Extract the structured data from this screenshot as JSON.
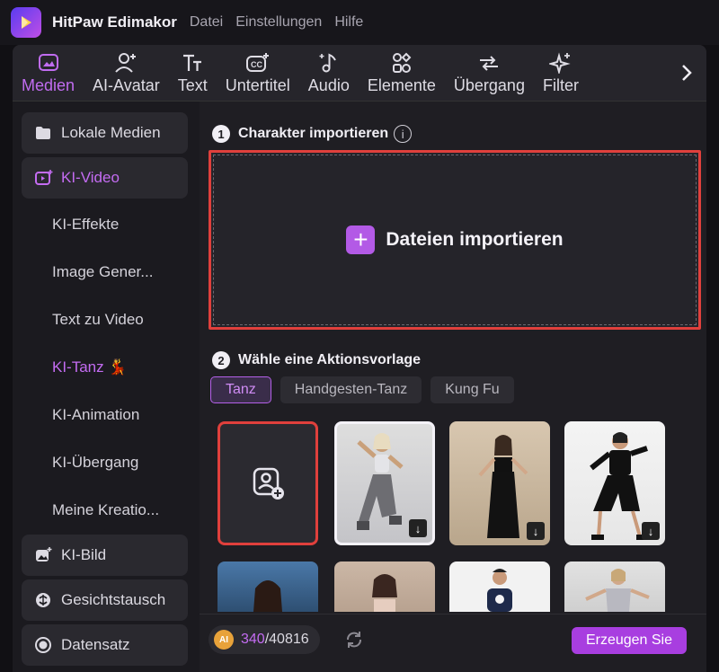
{
  "app": {
    "title": "HitPaw Edimakor"
  },
  "menu": [
    "Datei",
    "Einstellungen",
    "Hilfe"
  ],
  "toolbar": {
    "items": [
      {
        "label": "Medien",
        "icon": "media-icon",
        "active": true
      },
      {
        "label": "AI-Avatar",
        "icon": "avatar-icon"
      },
      {
        "label": "Text",
        "icon": "text-icon"
      },
      {
        "label": "Untertitel",
        "icon": "subtitle-icon"
      },
      {
        "label": "Audio",
        "icon": "audio-icon"
      },
      {
        "label": "Elemente",
        "icon": "elements-icon"
      },
      {
        "label": "Übergang",
        "icon": "transition-icon"
      },
      {
        "label": "Filter",
        "icon": "filter-icon"
      }
    ]
  },
  "sidebar": {
    "items": [
      {
        "label": "Lokale Medien",
        "icon": "folder-icon"
      },
      {
        "label": "KI-Video",
        "icon": "ai-video-icon",
        "active": true
      },
      {
        "label": "KI-Bild",
        "icon": "ai-image-icon"
      },
      {
        "label": "Gesichtstausch",
        "icon": "face-swap-icon"
      },
      {
        "label": "Datensatz",
        "icon": "dataset-icon"
      }
    ],
    "subitems": [
      {
        "label": "KI-Effekte"
      },
      {
        "label": "Image Gener..."
      },
      {
        "label": "Text zu Video"
      },
      {
        "label": "KI-Tanz 💃",
        "active": true
      },
      {
        "label": "KI-Animation"
      },
      {
        "label": "KI-Übergang"
      },
      {
        "label": "Meine Kreatio..."
      }
    ]
  },
  "main": {
    "step1": {
      "num": "1",
      "title": "Charakter importieren"
    },
    "import_label": "Dateien importieren",
    "step2": {
      "num": "2",
      "title": "Wähle eine Aktionsvorlage"
    },
    "tabs": [
      "Tanz",
      "Handgesten-Tanz",
      "Kung Fu"
    ],
    "credits": {
      "coin": "AI",
      "used": "340",
      "total": "/40816"
    },
    "generate_label": "Erzeugen Sie"
  },
  "colors": {
    "accent": "#b35ae6",
    "highlight": "#e0403c"
  }
}
